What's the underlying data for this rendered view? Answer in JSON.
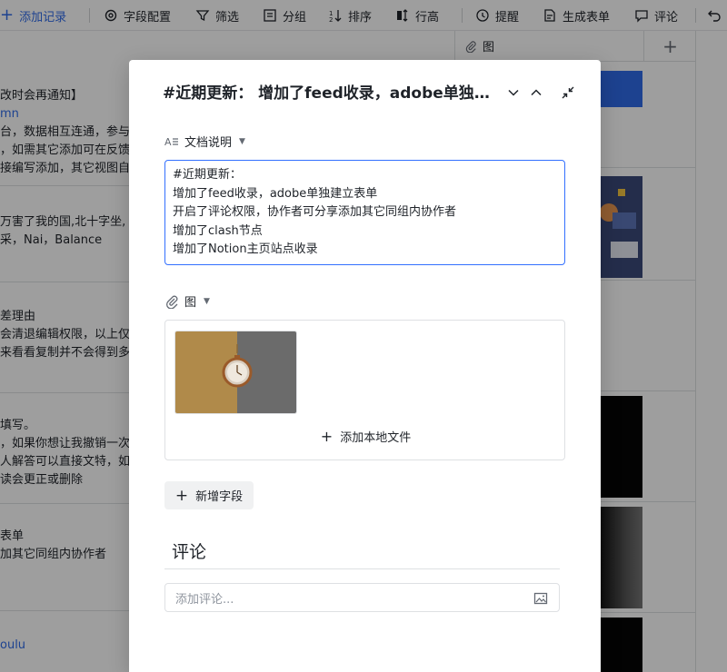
{
  "toolbar": {
    "add_record": "添加记录",
    "field_config": "字段配置",
    "filter": "筛选",
    "group": "分组",
    "sort": "排序",
    "row_height": "行高",
    "remind": "提醒",
    "generate_form": "生成表单",
    "comment": "评论"
  },
  "table": {
    "attachment_column": "图",
    "rows": [
      [
        "改时会再通知】",
        "mn",
        "台，数据相互连通，参与",
        "，如需其它添加可在反馈",
        "接编写添加，其它视图自"
      ],
      [
        "万害了我的国,北十字坐,",
        "采，Nai，Balance"
      ],
      [
        "差理由",
        "会清退编辑权限，以上仅",
        "来看看复制并不会得到多"
      ],
      [
        "填写。",
        "，如果你想让我撤销一次",
        "人解答可以直接文特，如",
        "读会更正或删除"
      ],
      [
        "表单",
        "加其它同组内协作者"
      ],
      [
        "oulu"
      ]
    ]
  },
  "modal": {
    "title": "#近期更新： 增加了feed收录，adobe单独建立表单",
    "doc_field_label": "文档说明",
    "doc_lines": [
      "#近期更新：",
      "增加了feed收录，adobe单独建立表单",
      "开启了评论权限，协作者可分享添加其它同组内协作者",
      "增加了clash节点",
      "增加了Notion主页站点收录"
    ],
    "attachment_field_label": "图",
    "add_local_file": "添加本地文件",
    "new_field": "新增字段",
    "comment_title": "评论",
    "comment_placeholder": "添加评论..."
  },
  "colors": {
    "accent": "#3370ff",
    "link": "#2f6be8",
    "border": "#dee0e3"
  }
}
